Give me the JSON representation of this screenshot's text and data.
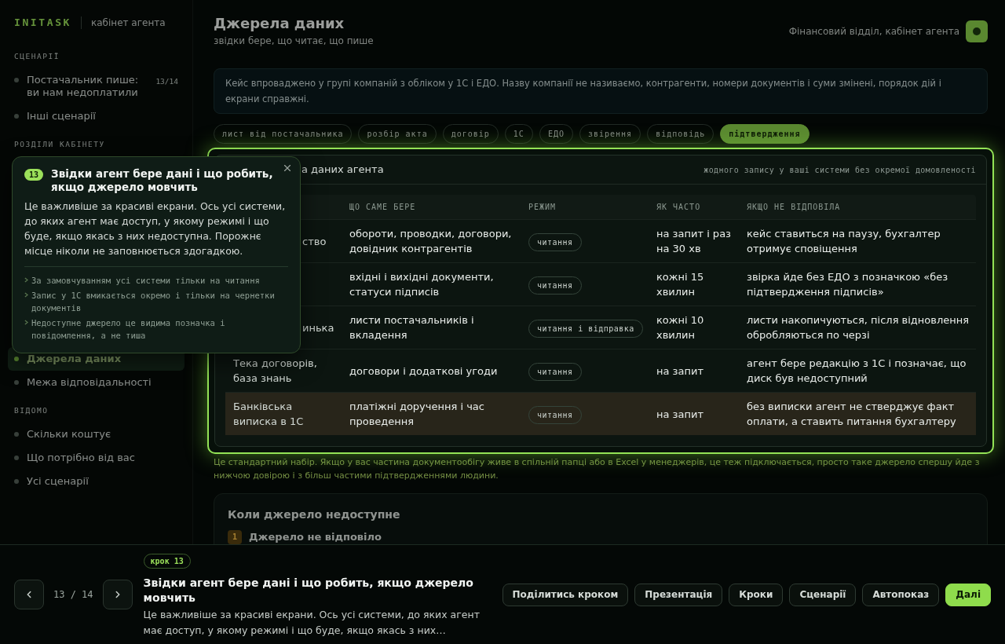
{
  "sidebar": {
    "logo": "INITASK",
    "subtitle": "кабінет агента",
    "sections": [
      {
        "heading": "СЦЕНАРІЇ",
        "covered": false,
        "items": [
          {
            "label": "Постачальник пише: ви нам недоплатили",
            "count": "13/14",
            "selected": false
          },
          {
            "label": "Інші сценарії",
            "selected": false
          }
        ]
      },
      {
        "heading": "РОЗДІЛИ КАБІНЕТУ",
        "covered": true,
        "items": [
          {
            "label": "Джерела даних",
            "selected": true
          },
          {
            "label": "Межа відповідальності",
            "selected": false
          }
        ]
      },
      {
        "heading": "ВІДОМО",
        "covered": false,
        "items": [
          {
            "label": "Скільки коштує",
            "selected": false
          },
          {
            "label": "Що потрібно від вас",
            "selected": false
          },
          {
            "label": "Усі сценарії",
            "selected": false
          }
        ]
      }
    ]
  },
  "header": {
    "title": "Джерела даних",
    "subtitle": "звідки бере, що читає, що пише",
    "account": "Фінансовий відділ, кабінет агента"
  },
  "intro": "Кейс впроваджено у групі компаній з обліком у 1С і ЕДО. Назву компанії не називаємо, контрагенти, номери документів і суми змінені, порядок дій і екрани справжні.",
  "chips": [
    {
      "label": "лист від постачальника",
      "selected": false
    },
    {
      "label": "розбір акта",
      "selected": false
    },
    {
      "label": "договір",
      "selected": false
    },
    {
      "label": "1С",
      "selected": false
    },
    {
      "label": "ЕДО",
      "selected": false
    },
    {
      "label": "звірення",
      "selected": false
    },
    {
      "label": "відповідь",
      "selected": false
    },
    {
      "label": "підтвердження",
      "selected": true
    }
  ],
  "data_card": {
    "title": "а даних агента",
    "title_covered": true,
    "note": "жодного запису у ваші системи без окремої домовленості",
    "columns": [
      "ЩО САМЕ БЕРЕ",
      "РЕЖИМ",
      "ЯК ЧАСТО",
      "ЯКЩО НЕ ВІДПОВІЛА"
    ],
    "rows": [
      {
        "source": "ство",
        "source_covered": true,
        "takes": "обороти, проводки, договори, довідник контрагентів",
        "mode": "читання",
        "frequency": "на запит і раз на 30 хв",
        "on_failure": "кейс ставиться на паузу, бухгалтер отримує сповіщення",
        "selected": false
      },
      {
        "takes": "вхідні і вихідні документи, статуси підписів",
        "mode": "читання",
        "frequency": "кожні 15 хвилин",
        "on_failure": "звірка йде без ЕДО з позначкою «без підтвердження підписів»",
        "selected": false
      },
      {
        "source": "инька",
        "source_covered": true,
        "takes": "листи постачальників і вкладення",
        "mode": "читання і відправка",
        "frequency": "кожні 10 хвилин",
        "on_failure": "листи накопичуються, після відновлення обробляються по черзі",
        "selected": false
      },
      {
        "source": "Тека договорів, база знань",
        "source_covered": false,
        "takes": "договори і додаткові угоди",
        "mode": "читання",
        "frequency": "на запит",
        "on_failure": "агент бере редакцію з 1С і позначає, що диск був недоступний",
        "selected": false
      },
      {
        "source": "Банківська виписка в 1С",
        "source_covered": false,
        "takes": "платіжні доручення і час проведення",
        "mode": "читання",
        "frequency": "на запит",
        "on_failure": "без виписки агент не стверджує факт оплати, а ставить питання бухгалтеру",
        "selected": true
      }
    ]
  },
  "footnote": "Це стандартний набір. Якщо у вас частина документообігу живе в спільній папці або в Excel у менеджерів, це теж підключається, просто таке джерело спершу йде з нижчою довірою і з більш частими підтвердженнями людини.",
  "unavailable": {
    "title": "Коли джерело недоступне",
    "steps": [
      {
        "number": "1",
        "label": "Джерело не відповіло"
      }
    ]
  },
  "tooltip": {
    "badge": "13",
    "title": "Звідки агент бере дані і що робить, якщо джерело мовчить",
    "body": "Це важливіше за красиві екрани. Ось усі системи, до яких агент має доступ, у якому режимі і що буде, якщо якась з них недоступна. Порожнє місце ніколи не заповнюється здогадкою.",
    "bullets": [
      "За замовчуванням усі системи тільки на читання",
      "Запис у 1С вмикається окремо і тільки на чернетки документів",
      "Недоступне джерело це видима позначка і повідомлення, а не тиша"
    ]
  },
  "player": {
    "counter": "13 / 14",
    "step_tag": "крок 13",
    "title": "Звідки агент бере дані і що робить, якщо джерело мовчить",
    "description": "Це важливіше за красиві екрани. Ось усі системи, до яких агент має доступ, у якому режимі і що буде, якщо якась з них…",
    "buttons": [
      {
        "label": "Поділитись кроком",
        "primary": false
      },
      {
        "label": "Презентація",
        "primary": false
      },
      {
        "label": "Кроки",
        "primary": false
      },
      {
        "label": "Сценарії",
        "primary": false
      },
      {
        "label": "Автопоказ",
        "primary": false
      },
      {
        "label": "Далі",
        "primary": true
      }
    ]
  }
}
